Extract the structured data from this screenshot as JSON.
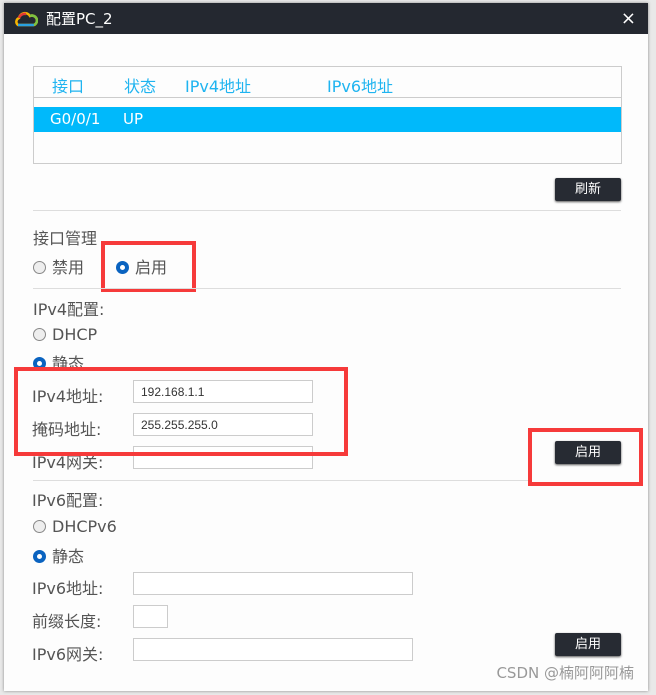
{
  "window": {
    "title": "配置PC_2",
    "close": "×"
  },
  "table": {
    "headers": [
      "接口",
      "状态",
      "IPv4地址",
      "IPv6地址"
    ],
    "rows": [
      {
        "interface": "G0/0/1",
        "status": "UP",
        "ipv4": "",
        "ipv6": ""
      }
    ]
  },
  "refresh_label": "刷新",
  "iface_mgmt": {
    "label": "接口管理",
    "options": [
      "禁用",
      "启用"
    ],
    "selected": "启用"
  },
  "ipv4": {
    "label": "IPv4配置:",
    "options": [
      "DHCP",
      "静态"
    ],
    "selected": "静态",
    "addr_label": "IPv4地址:",
    "addr": "192.168.1.1",
    "mask_label": "掩码地址:",
    "mask": "255.255.255.0",
    "gw_label": "IPv4网关:",
    "gw": "",
    "apply": "启用"
  },
  "ipv6": {
    "label": "IPv6配置:",
    "options": [
      "DHCPv6",
      "静态"
    ],
    "selected": "静态",
    "addr_label": "IPv6地址:",
    "addr": "",
    "prefix_label": "前缀长度:",
    "prefix": "",
    "gw_label": "IPv6网关:",
    "gw": "",
    "apply": "启用"
  },
  "watermark": "CSDN @楠阿阿阿楠",
  "colors": {
    "accent": "#00b9fb",
    "highlight": "#f63a3a",
    "button": "#272b33"
  }
}
